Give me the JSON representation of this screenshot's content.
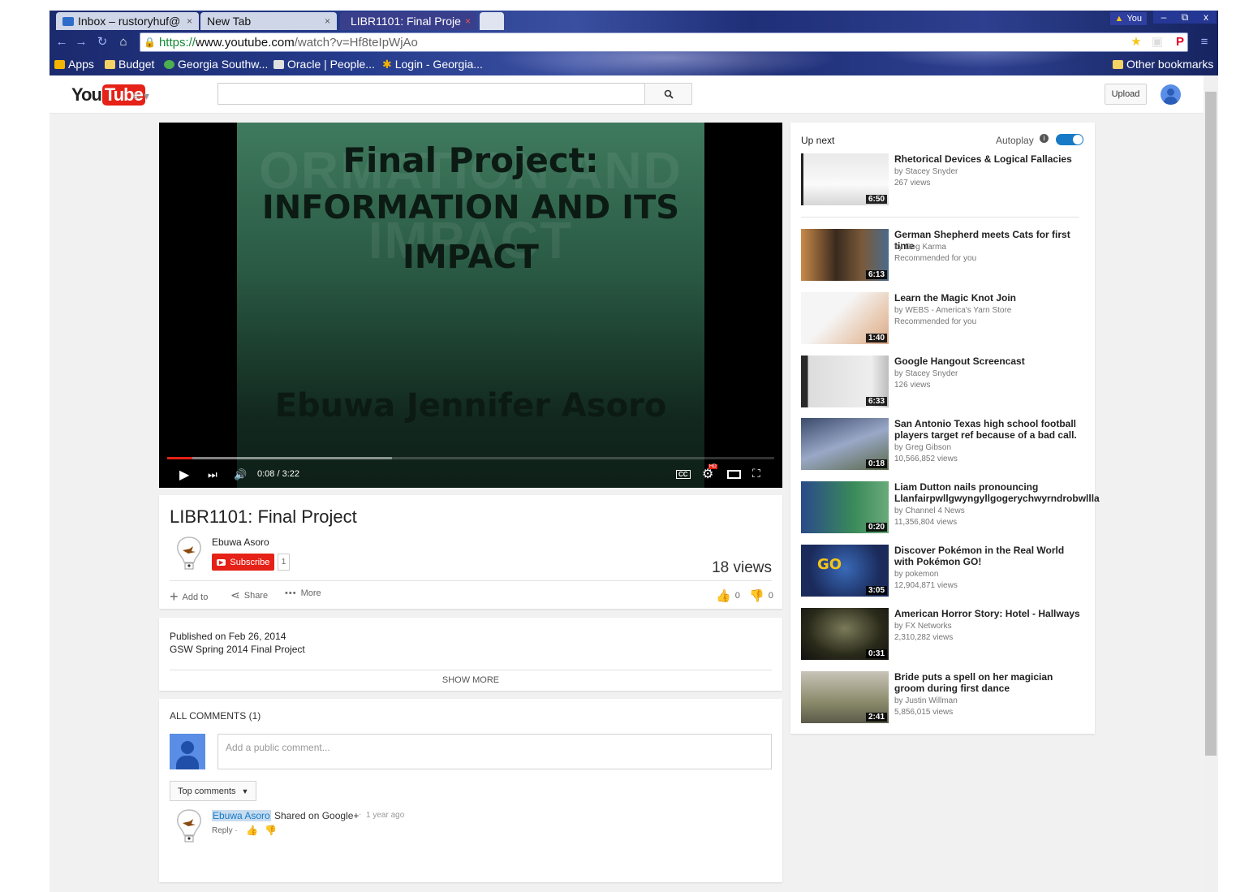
{
  "browser": {
    "tabs": [
      {
        "label": "Inbox – rustoryhuf@",
        "close": "×"
      },
      {
        "label": "New Tab",
        "close": "×"
      },
      {
        "label": "LIBR1101: Final Proje",
        "close": "×"
      }
    ],
    "user_badge": "You",
    "window_buttons": [
      "–",
      "⧉",
      "x"
    ],
    "url": {
      "scheme": "https://",
      "host": "www.youtube.com",
      "path": "/watch?v=Hf8teIpWjAo"
    },
    "bookmarks": [
      "Apps",
      "Budget",
      "Georgia Southw...",
      "Oracle | People...",
      "Login - Georgia..."
    ],
    "other_bookmarks": "Other bookmarks"
  },
  "youtube": {
    "logo_you": "You",
    "logo_tube": "Tube",
    "search_placeholder": "",
    "upload_label": "Upload"
  },
  "player": {
    "slide_title_line1": "Final Project:",
    "slide_title_line2": "INFORMATION AND ITS",
    "slide_title_line3": "IMPACT",
    "slide_author": "Ebuwa Jennifer Asoro",
    "ghost_line1": "ORMATION AND",
    "ghost_line2": "IMPACT",
    "time": "0:08 / 3:22",
    "played_fraction": 0.041,
    "buffered_fraction": 0.37,
    "cc": "CC",
    "hd": "HD"
  },
  "video": {
    "title": "LIBR1101: Final Project",
    "channel": "Ebuwa Asoro",
    "subscribe_label": "Subscribe",
    "subscriber_count": "1",
    "views": "18 views",
    "add_to": "Add to",
    "share": "Share",
    "more": "More",
    "likes": "0",
    "dislikes": "0"
  },
  "description": {
    "published": "Published on Feb 26, 2014",
    "text": "GSW Spring 2014 Final Project",
    "show_more": "SHOW MORE"
  },
  "comments": {
    "header": "ALL COMMENTS (1)",
    "placeholder": "Add a public comment...",
    "sort_label": "Top comments",
    "items": [
      {
        "author": "Ebuwa Asoro",
        "shared": "Shared on Google+",
        "dot": "·",
        "time": "1 year ago",
        "reply": "Reply ·"
      }
    ]
  },
  "upnext": {
    "header": "Up next",
    "autoplay_label": "Autoplay",
    "autoplay_on": true,
    "items": [
      {
        "title": "Rhetorical Devices & Logical Fallacies",
        "channel": "by Stacey Snyder",
        "meta": "267 views",
        "duration": "6:50"
      },
      {
        "title": "German Shepherd meets Cats for first time",
        "channel": "by Dog Karma",
        "meta": "Recommended for you",
        "duration": "6:13"
      },
      {
        "title": "Learn the Magic Knot Join",
        "channel": "by WEBS - America's Yarn Store",
        "meta": "Recommended for you",
        "duration": "1:40"
      },
      {
        "title": "Google Hangout Screencast",
        "channel": "by Stacey Snyder",
        "meta": "126 views",
        "duration": "6:33"
      },
      {
        "title": "San Antonio Texas high school football players target ref because of a bad call.",
        "channel": "by Greg Gibson",
        "meta": "10,566,852 views",
        "duration": "0:18"
      },
      {
        "title": "Liam Dutton nails pronouncing Llanfairpwllgwyngyllgogerychwyrndrobwllla",
        "channel": "by Channel 4 News",
        "meta": "11,356,804 views",
        "duration": "0:20"
      },
      {
        "title": "Discover Pokémon in the Real World with Pokémon GO!",
        "channel": "by pokemon",
        "meta": "12,904,871 views",
        "duration": "3:05"
      },
      {
        "title": "American Horror Story: Hotel - Hallways",
        "channel": "by FX Networks",
        "meta": "2,310,282 views",
        "duration": "0:31"
      },
      {
        "title": "Bride puts a spell on her magician groom during first dance",
        "channel": "by Justin Willman",
        "meta": "5,856,015 views",
        "duration": "2:41"
      }
    ]
  },
  "colors": {
    "youtube_red": "#e62117",
    "link_blue": "#167ac6",
    "browser_frame": "#243a8a"
  }
}
